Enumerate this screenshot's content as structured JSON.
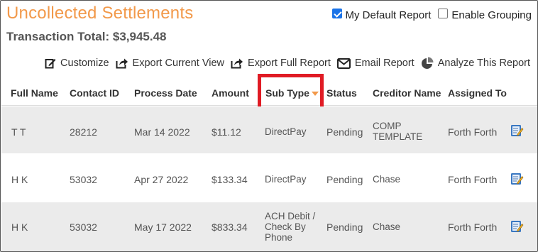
{
  "header": {
    "title": "Uncollected Settlements",
    "total": "Transaction Total: $3,945.48"
  },
  "options": {
    "default_report": {
      "label": "My Default Report",
      "checked": true
    },
    "enable_grouping": {
      "label": "Enable Grouping",
      "checked": false
    }
  },
  "toolbar": {
    "customize": "Customize",
    "export_current": "Export Current View",
    "export_full": "Export Full Report",
    "email": "Email Report",
    "analyze": "Analyze This Report"
  },
  "columns": [
    "Full Name",
    "Contact ID",
    "Process Date",
    "Amount",
    "Sub Type",
    "Status",
    "Creditor Name",
    "Assigned To"
  ],
  "rows": [
    {
      "name": "T T",
      "contact_id": "28212",
      "date": "Mar 14 2022",
      "amount": "$11.12",
      "sub_type": [
        "DirectPay"
      ],
      "status": "Pending",
      "creditor": [
        "COMP",
        "TEMPLATE"
      ],
      "assigned": "Forth Forth"
    },
    {
      "name": "H K",
      "contact_id": "53032",
      "date": "Apr 27 2022",
      "amount": "$133.34",
      "sub_type": [
        "DirectPay"
      ],
      "status": "Pending",
      "creditor": [
        "Chase"
      ],
      "assigned": "Forth Forth"
    },
    {
      "name": "H K",
      "contact_id": "53032",
      "date": "May 17 2022",
      "amount": "$833.34",
      "sub_type": [
        "ACH Debit /",
        "Check By",
        "Phone"
      ],
      "status": "Pending",
      "creditor": [
        "Chase"
      ],
      "assigned": "Forth Forth"
    }
  ],
  "colors": {
    "title": "#f2994a",
    "highlight": "#e01b24",
    "row_shade": "#ebebeb"
  },
  "icons": [
    "customize-icon",
    "export-icon",
    "email-icon",
    "pie-chart-icon",
    "edit-note-icon"
  ]
}
